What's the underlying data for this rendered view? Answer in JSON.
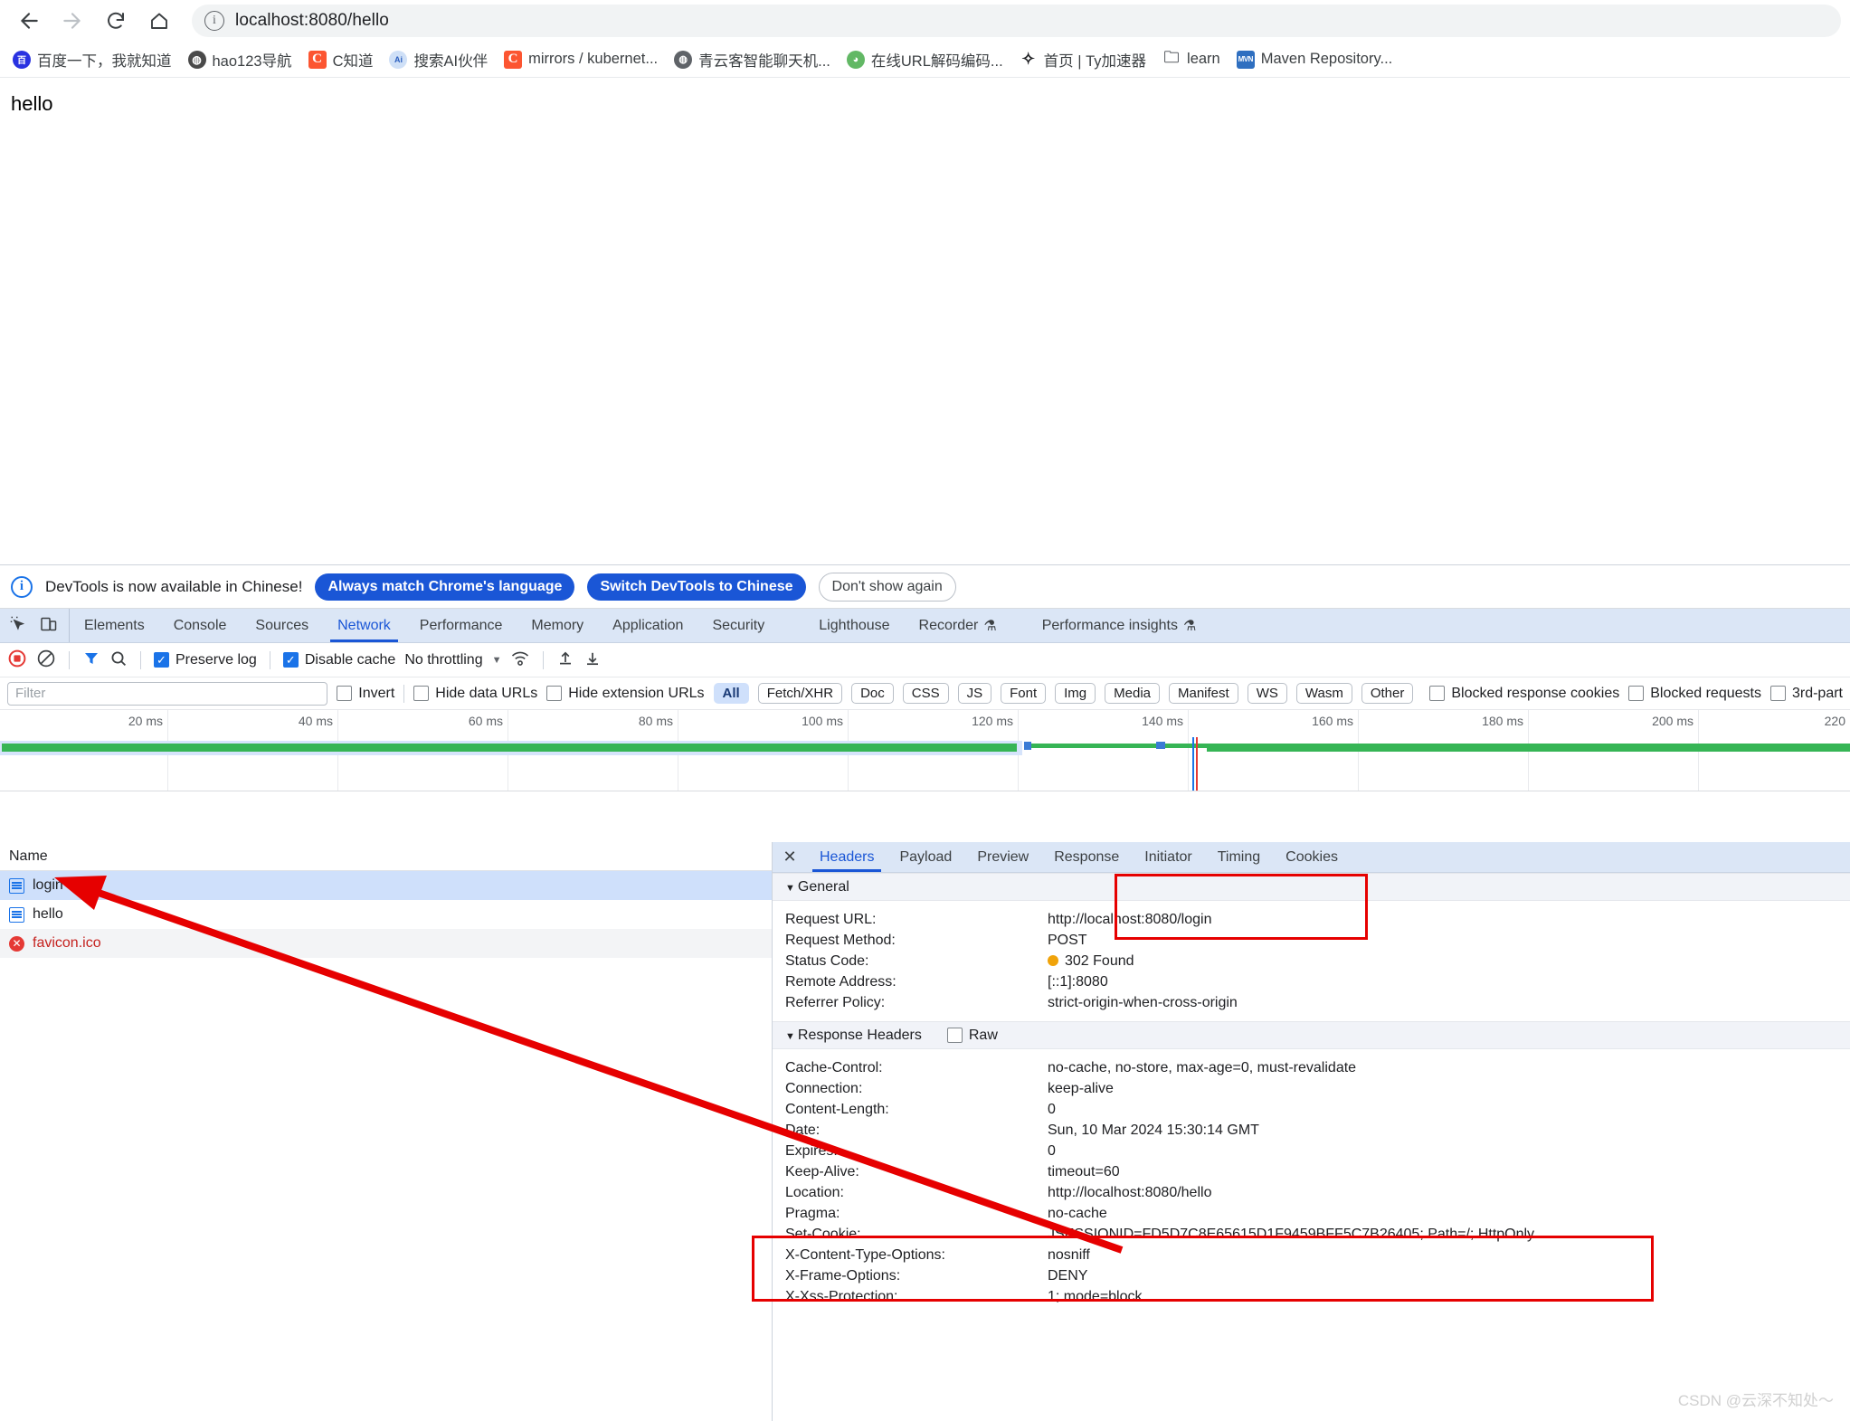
{
  "browser": {
    "nav": {
      "back": "back-arrow",
      "forward": "forward-arrow",
      "reload": "reload",
      "home": "home"
    },
    "omnibox": {
      "url": "localhost:8080/hello",
      "info_icon": "info-circle"
    },
    "bookmarks": [
      {
        "label": "百度一下，我就知道",
        "icon": "baidu-icon",
        "icon_text": "百"
      },
      {
        "label": "hao123导航",
        "icon": "hao123-icon",
        "icon_text": "◍"
      },
      {
        "label": "C知道",
        "icon": "csdn-c-icon",
        "icon_text": "C"
      },
      {
        "label": "搜索AI伙伴",
        "icon": "ai-icon",
        "icon_text": "Ai"
      },
      {
        "label": "mirrors / kubernet...",
        "icon": "csdn-c-icon",
        "icon_text": "C"
      },
      {
        "label": "青云客智能聊天机...",
        "icon": "globe-icon",
        "icon_text": "◍"
      },
      {
        "label": "在线URL解码编码...",
        "icon": "frog-icon",
        "icon_text": "🐸"
      },
      {
        "label": "首页 | Ty加速器",
        "icon": "star-icon",
        "icon_text": "✩"
      },
      {
        "label": "learn",
        "icon": "folder-icon",
        "icon_text": "🗀"
      },
      {
        "label": "Maven Repository...",
        "icon": "maven-icon",
        "icon_text": "MVN"
      }
    ]
  },
  "page": {
    "body_text": "hello"
  },
  "devtools": {
    "banner": {
      "message": "DevTools is now available in Chinese!",
      "btn_always": "Always match Chrome's language",
      "btn_switch": "Switch DevTools to Chinese",
      "btn_dismiss": "Don't show again"
    },
    "panel_tabs": [
      {
        "label": "Elements",
        "active": false
      },
      {
        "label": "Console",
        "active": false
      },
      {
        "label": "Sources",
        "active": false
      },
      {
        "label": "Network",
        "active": true
      },
      {
        "label": "Performance",
        "active": false
      },
      {
        "label": "Memory",
        "active": false
      },
      {
        "label": "Application",
        "active": false
      },
      {
        "label": "Security",
        "active": false
      },
      {
        "label": "Lighthouse",
        "active": false
      },
      {
        "label": "Recorder",
        "active": false,
        "beaker": "⚗"
      },
      {
        "label": "Performance insights",
        "active": false,
        "beaker": "⚗"
      }
    ],
    "controls": {
      "record": "record-button",
      "clear": "clear-button",
      "filter": "filter-funnel",
      "search": "search-magnifier",
      "preserve_log": "Preserve log",
      "preserve_log_checked": true,
      "disable_cache": "Disable cache",
      "disable_cache_checked": true,
      "throttling": "No throttling",
      "import_har": "import-har",
      "export_har": "export-har"
    },
    "filters": {
      "filter_placeholder": "Filter",
      "filter_value": "",
      "invert": "Invert",
      "hide_data_urls": "Hide data URLs",
      "hide_extension_urls": "Hide extension URLs",
      "types": [
        "All",
        "Fetch/XHR",
        "Doc",
        "CSS",
        "JS",
        "Font",
        "Img",
        "Media",
        "Manifest",
        "WS",
        "Wasm",
        "Other"
      ],
      "selected_type": "All",
      "blocked_response_cookies": "Blocked response cookies",
      "blocked_requests": "Blocked requests",
      "third_party": "3rd-part"
    },
    "overview": {
      "ticks": [
        "20 ms",
        "40 ms",
        "60 ms",
        "80 ms",
        "100 ms",
        "120 ms",
        "140 ms",
        "160 ms",
        "180 ms",
        "200 ms",
        "220"
      ]
    },
    "request_table": {
      "column_name": "Name",
      "rows": [
        {
          "name": "login",
          "icon": "document-icon",
          "selected": true,
          "error": false
        },
        {
          "name": "hello",
          "icon": "document-icon",
          "selected": false,
          "error": false
        },
        {
          "name": "favicon.ico",
          "icon": "error-icon",
          "selected": false,
          "error": true
        }
      ]
    },
    "detail": {
      "close": "✕",
      "tabs": [
        {
          "label": "Headers",
          "active": true
        },
        {
          "label": "Payload",
          "active": false
        },
        {
          "label": "Preview",
          "active": false
        },
        {
          "label": "Response",
          "active": false
        },
        {
          "label": "Initiator",
          "active": false
        },
        {
          "label": "Timing",
          "active": false
        },
        {
          "label": "Cookies",
          "active": false
        }
      ],
      "general": {
        "title": "General",
        "rows": [
          {
            "name": "Request URL:",
            "value": "http://localhost:8080/login"
          },
          {
            "name": "Request Method:",
            "value": "POST"
          },
          {
            "name": "Status Code:",
            "value": "302 Found",
            "status_dot": "#f0a30a"
          },
          {
            "name": "Remote Address:",
            "value": "[::1]:8080"
          },
          {
            "name": "Referrer Policy:",
            "value": "strict-origin-when-cross-origin"
          }
        ]
      },
      "response_headers": {
        "title": "Response Headers",
        "raw_label": "Raw",
        "raw_checked": false,
        "rows": [
          {
            "name": "Cache-Control:",
            "value": "no-cache, no-store, max-age=0, must-revalidate"
          },
          {
            "name": "Connection:",
            "value": "keep-alive"
          },
          {
            "name": "Content-Length:",
            "value": "0"
          },
          {
            "name": "Date:",
            "value": "Sun, 10 Mar 2024 15:30:14 GMT"
          },
          {
            "name": "Expires:",
            "value": "0"
          },
          {
            "name": "Keep-Alive:",
            "value": "timeout=60"
          },
          {
            "name": "Location:",
            "value": "http://localhost:8080/hello"
          },
          {
            "name": "Pragma:",
            "value": "no-cache"
          },
          {
            "name": "Set-Cookie:",
            "value": "JSESSIONID=FD5D7C8E65615D1F9459BFF5C7B26405; Path=/; HttpOnly"
          },
          {
            "name": "X-Content-Type-Options:",
            "value": "nosniff"
          },
          {
            "name": "X-Frame-Options:",
            "value": "DENY"
          },
          {
            "name": "X-Xss-Protection:",
            "value": "1; mode=block"
          }
        ]
      }
    }
  },
  "annotations": {
    "highlight_color": "#e60000",
    "arrow": "points from Location value to hello request row"
  },
  "watermark": "CSDN @云深不知处～"
}
